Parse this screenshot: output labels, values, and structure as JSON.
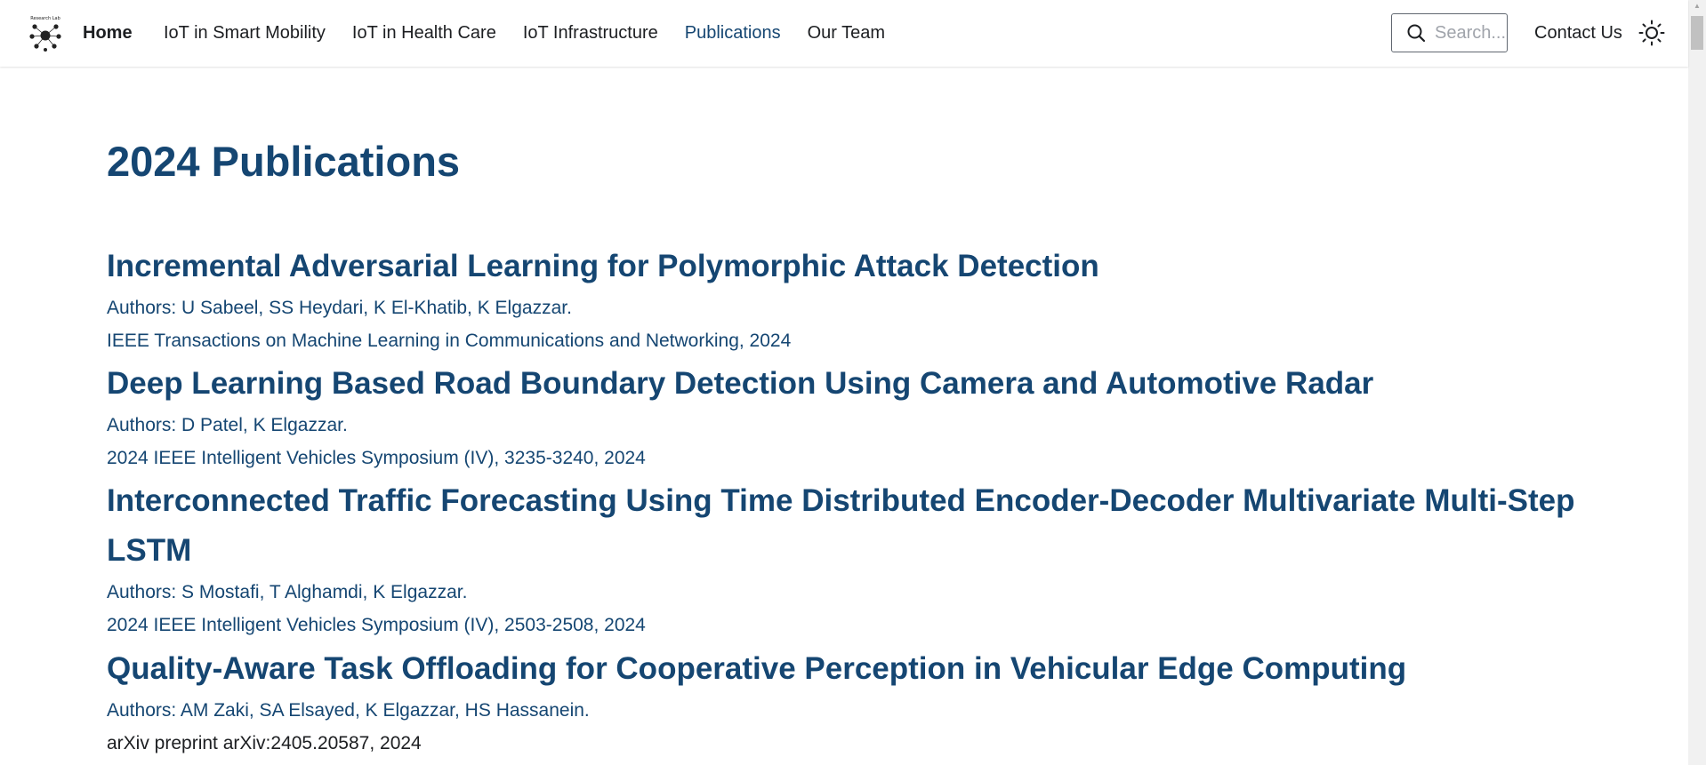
{
  "nav": {
    "logo_icon": "research-lab-logo",
    "home_label": "Home",
    "links": [
      {
        "label": "IoT in Smart Mobility",
        "active": false
      },
      {
        "label": "IoT in Health Care",
        "active": false
      },
      {
        "label": "IoT Infrastructure",
        "active": false
      },
      {
        "label": "Publications",
        "active": true
      },
      {
        "label": "Our Team",
        "active": false
      }
    ],
    "search_placeholder": "Search...",
    "contact_label": "Contact Us",
    "theme_icon": "sun-icon"
  },
  "page": {
    "title": "2024 Publications"
  },
  "publications": [
    {
      "title": "Incremental Adversarial Learning for Polymorphic Attack Detection",
      "authors": "Authors: U Sabeel, SS Heydari, K El-Khatib, K Elgazzar.",
      "venue": "IEEE Transactions on Machine Learning in Communications and Networking, 2024"
    },
    {
      "title": "Deep Learning Based Road Boundary Detection Using Camera and Automotive Radar",
      "authors": "Authors: D Patel, K Elgazzar.",
      "venue": "2024 IEEE Intelligent Vehicles Symposium (IV), 3235-3240, 2024"
    },
    {
      "title": "Interconnected Traffic Forecasting Using Time Distributed Encoder-Decoder Multivariate Multi-Step LSTM",
      "authors": "Authors: S Mostafi, T Alghamdi, K Elgazzar.",
      "venue": "2024 IEEE Intelligent Vehicles Symposium (IV), 2503-2508, 2024"
    },
    {
      "title": "Quality-Aware Task Offloading for Cooperative Perception in Vehicular Edge Computing",
      "authors": "Authors: AM Zaki, SA Elsayed, K Elgazzar, HS Hassanein.",
      "venue": "arXiv preprint arXiv:2405.20587, 2024"
    }
  ],
  "colors": {
    "accent": "#154672",
    "text": "#1c1e21"
  }
}
